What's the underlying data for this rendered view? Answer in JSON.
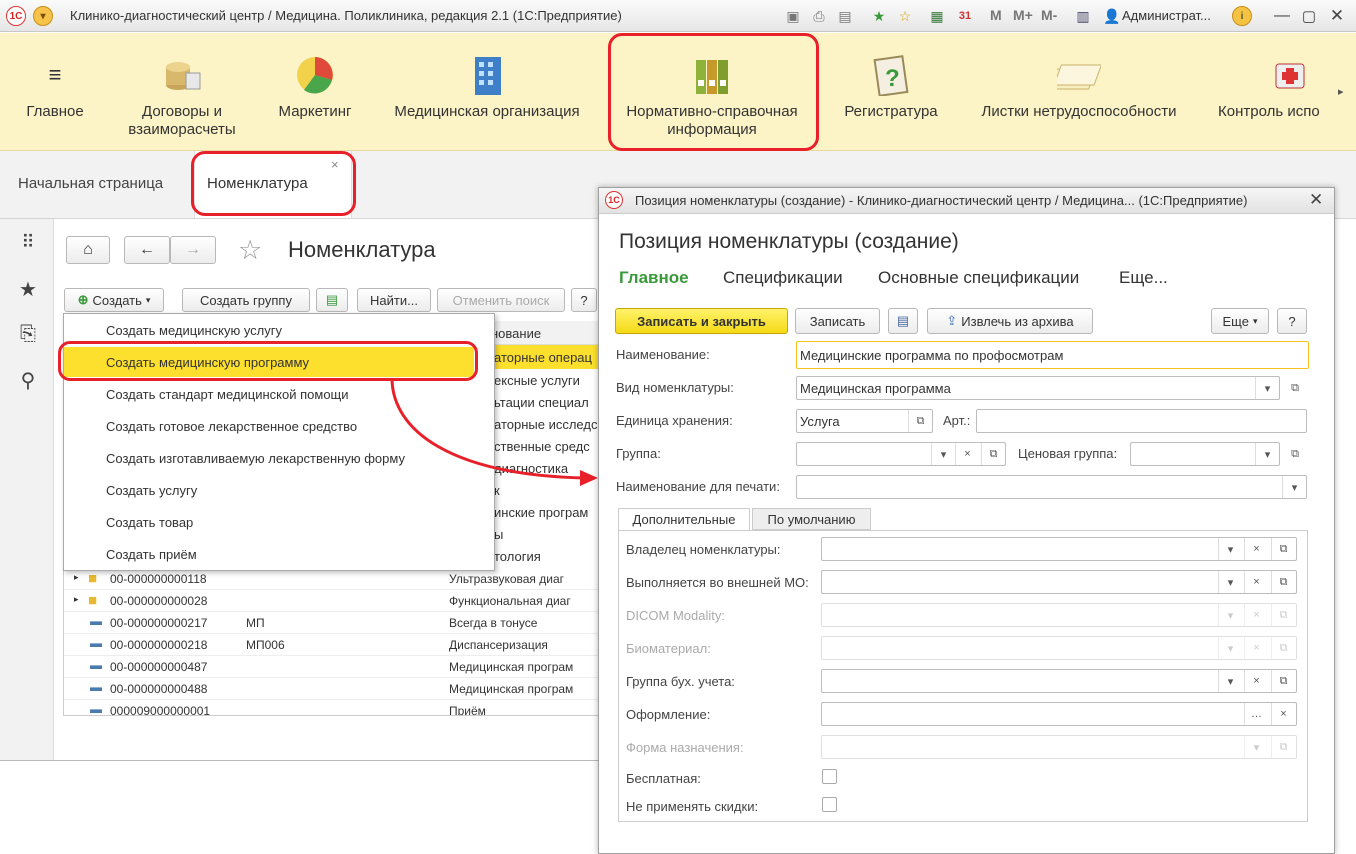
{
  "app": {
    "title": "Клинико-диагностический центр / Медицина. Поликлиника, редакция 2.1  (1С:Предприятие)",
    "user": "Администрат...",
    "m_buttons": [
      "M",
      "M+",
      "M-"
    ]
  },
  "sections": [
    {
      "label": "Главное",
      "icon": "menu-icon"
    },
    {
      "label": "Договоры и\nвзаиморасчеты",
      "icon": "coins-icon"
    },
    {
      "label": "Маркетинг",
      "icon": "pie-chart-icon"
    },
    {
      "label": "Медицинская организация",
      "icon": "building-icon"
    },
    {
      "label": "Нормативно-справочная\nинформация",
      "icon": "binders-icon"
    },
    {
      "label": "Регистратура",
      "icon": "clipboard-question-icon"
    },
    {
      "label": "Листки нетрудоспособности",
      "icon": "sheets-icon"
    },
    {
      "label": "Контроль испо",
      "icon": "medical-kit-icon"
    }
  ],
  "tabs": {
    "home": "Начальная страница",
    "active": "Номенклатура",
    "close": "×"
  },
  "list": {
    "title": "Номенклатура",
    "create": "Создать",
    "create_group": "Создать группу",
    "find": "Найти...",
    "cancel_search": "Отменить поиск",
    "help": "?",
    "header_name": "нование",
    "menu_items": [
      "Создать медицинскую услугу",
      "Создать медицинскую программу",
      "Создать стандарт медицинской помощи",
      "Создать готовое лекарственное средство",
      "Создать изготавливаемую лекарственную форму",
      "Создать услугу",
      "Создать товар",
      "Создать приём"
    ],
    "partial_names": [
      "аторные операц",
      "ексные услуги",
      "ьтации специал",
      "аторные исследс",
      "ственные средс",
      "диагностика",
      "к",
      "инские програм",
      "ы",
      "тология"
    ],
    "rows": [
      {
        "code": "00-000000000118",
        "art": "",
        "name": "Ультразвуковая диаг",
        "folder": true
      },
      {
        "code": "00-000000000028",
        "art": "",
        "name": "Функциональная диаг",
        "folder": true
      },
      {
        "code": "00-000000000217",
        "art": "МП",
        "name": "Всегда в тонусе",
        "folder": false
      },
      {
        "code": "00-000000000218",
        "art": "МП006",
        "name": "Диспансеризация",
        "folder": false
      },
      {
        "code": "00-000000000487",
        "art": "",
        "name": "Медицинская програм",
        "folder": false
      },
      {
        "code": "00-000000000488",
        "art": "",
        "name": "Медицинская програм",
        "folder": false
      },
      {
        "code": "000009000000001",
        "art": "",
        "name": "Приём",
        "folder": false
      }
    ]
  },
  "dialog": {
    "window_title": "Позиция номенклатуры (создание) - Клинико-диагностический центр / Медицина... (1С:Предприятие)",
    "title": "Позиция номенклатуры (создание)",
    "tabs": [
      "Главное",
      "Спецификации",
      "Основные спецификации",
      "Еще..."
    ],
    "buttons": {
      "save_close": "Записать и закрыть",
      "save": "Записать",
      "extract": "Извлечь из архива",
      "more": "Еще",
      "help": "?"
    },
    "labels": {
      "name": "Наименование:",
      "kind": "Вид номенклатуры:",
      "unit": "Единица хранения:",
      "art": "Арт.:",
      "group": "Группа:",
      "price_group": "Ценовая группа:",
      "print_name": "Наименование для печати:"
    },
    "values": {
      "name": "Медицинские программа по профосмотрам",
      "kind": "Медицинская программа",
      "unit": "Услуга"
    },
    "subtabs": [
      "Дополнительные",
      "По умолчанию"
    ],
    "sublabels": [
      "Владелец номенклатуры:",
      "Выполняется во внешней МО:",
      "DICOM Modality:",
      "Биоматериал:",
      "Группа бух. учета:",
      "Оформление:",
      "Форма назначения:"
    ],
    "checks": [
      "Бесплатная:",
      "Не применять скидки:"
    ]
  },
  "colors": {
    "accent_yellow": "#fde02d",
    "highlight_red": "#e8202a",
    "section_bg": "#fcf3c6",
    "green_tab": "#3a9a3a"
  }
}
